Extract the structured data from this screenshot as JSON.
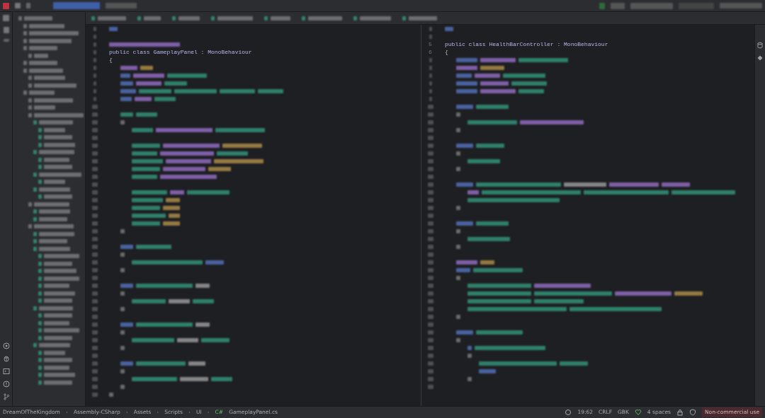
{
  "left_editor": {
    "declaration": "public class GameplayPanel : MonoBehaviour",
    "open_brace": "{"
  },
  "right_editor": {
    "line_numbers": [
      "5",
      "6"
    ],
    "declaration": "public class HealthBarController : MonoBehaviour",
    "open_brace": "{"
  },
  "status_bar": {
    "breadcrumb_separator": "›",
    "breadcrumbs": [
      "DreamOfTheKingdom",
      "Assembly-CSharp",
      "Assets",
      "Scripts",
      "UI",
      "GameplayPanel.cs"
    ],
    "file_type_badge": "C#",
    "caret_position": "19:62",
    "line_ending": "CRLF",
    "encoding": "GBK",
    "indent": "4 spaces",
    "license": "Non-commercial use"
  }
}
